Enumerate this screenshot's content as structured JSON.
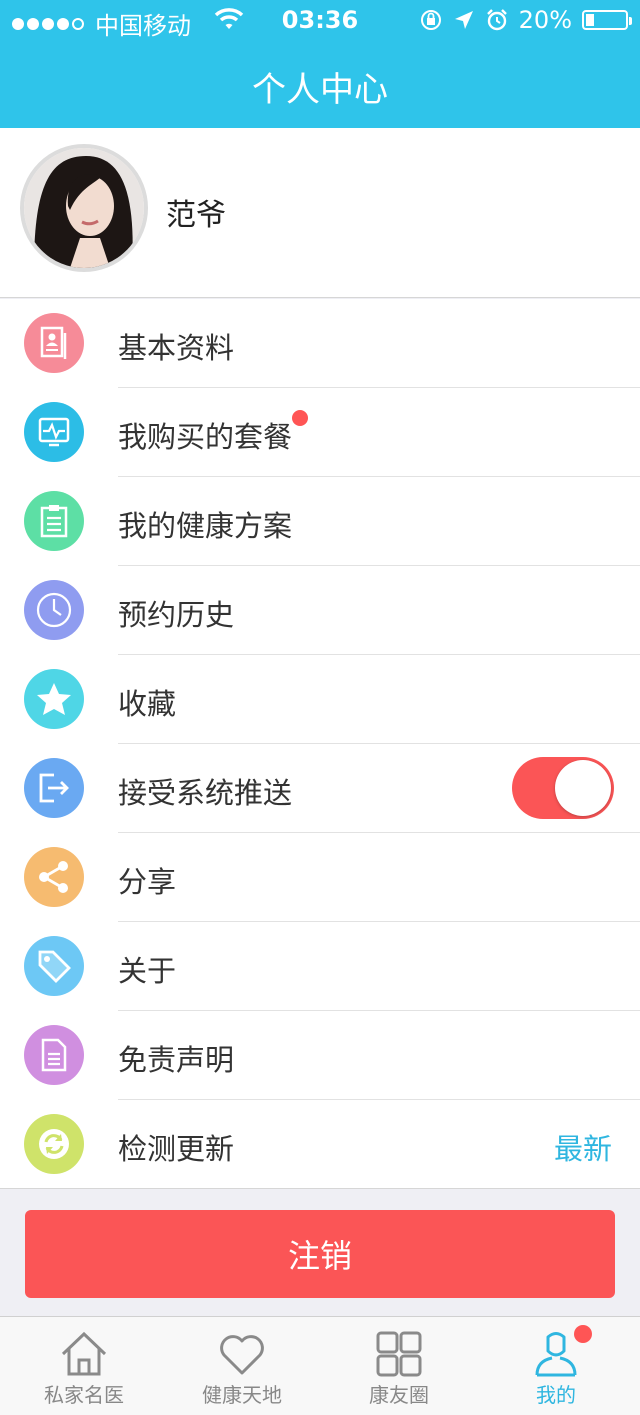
{
  "status_bar": {
    "carrier": "中国移动",
    "time": "03:36",
    "battery_percent": "20%",
    "battery_level": 0.2
  },
  "nav": {
    "title": "个人中心"
  },
  "profile": {
    "name": "范爷"
  },
  "menu": [
    {
      "label": "基本资料",
      "icon": "profile-card-icon",
      "color": "#f68b98"
    },
    {
      "label": "我购买的套餐",
      "icon": "health-monitor-icon",
      "color": "#2cbde6",
      "badge": true
    },
    {
      "label": "我的健康方案",
      "icon": "clipboard-icon",
      "color": "#5ddfa5"
    },
    {
      "label": "预约历史",
      "icon": "clock-icon",
      "color": "#8f9cf0"
    },
    {
      "label": "收藏",
      "icon": "star-icon",
      "color": "#4fd6e6"
    },
    {
      "label": "接受系统推送",
      "icon": "push-export-icon",
      "color": "#6aa9f2",
      "toggle_on": true
    },
    {
      "label": "分享",
      "icon": "share-icon",
      "color": "#f6bb70"
    },
    {
      "label": "关于",
      "icon": "tag-icon",
      "color": "#6dc8f5"
    },
    {
      "label": "免责声明",
      "icon": "document-icon",
      "color": "#d08fe0"
    },
    {
      "label": "检测更新",
      "icon": "refresh-icon",
      "color": "#cfe36a",
      "status": "最新"
    }
  ],
  "logout": {
    "label": "注销"
  },
  "tabs": [
    {
      "label": "私家名医",
      "icon": "home-icon"
    },
    {
      "label": "健康天地",
      "icon": "heart-icon"
    },
    {
      "label": "康友圈",
      "icon": "grid-icon"
    },
    {
      "label": "我的",
      "icon": "user-icon",
      "active": true,
      "badge": true
    }
  ],
  "colors": {
    "header": "#2fc4ea",
    "accent": "#2fb6e0",
    "danger": "#fb5556"
  }
}
